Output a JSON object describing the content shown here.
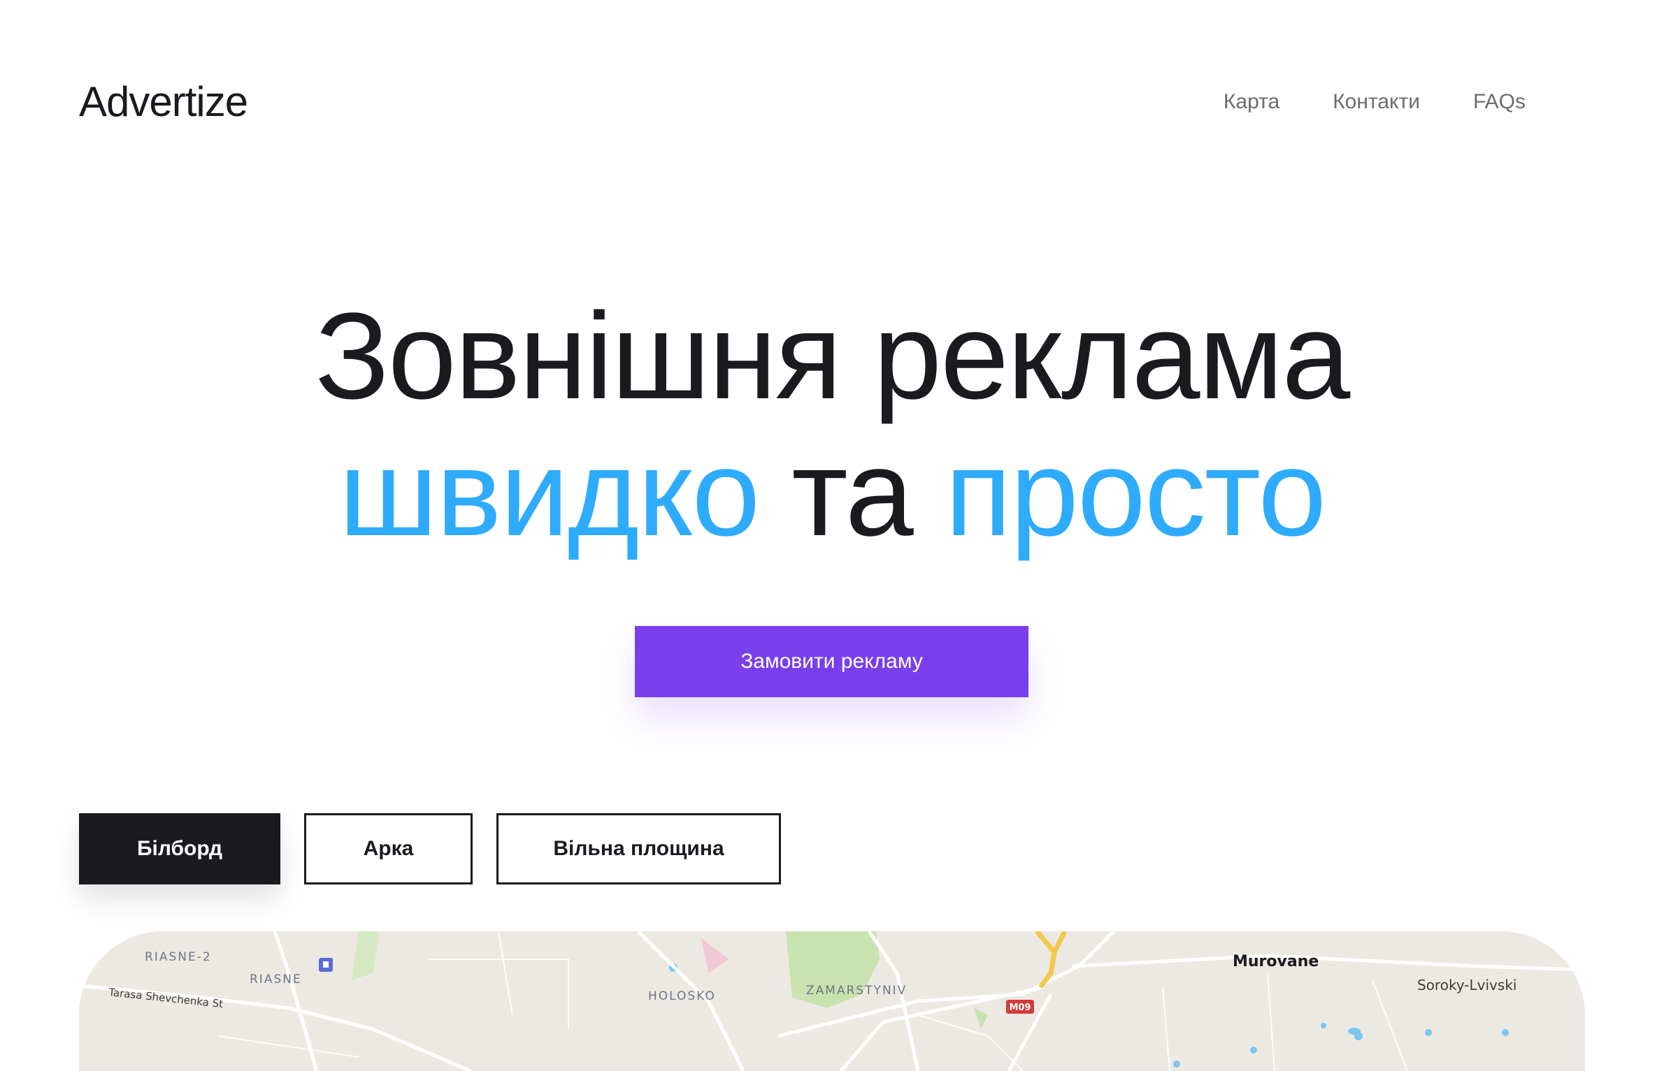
{
  "brand": {
    "logo": "Advertize"
  },
  "nav": {
    "items": [
      "Карта",
      "Контакти",
      "FAQs"
    ]
  },
  "hero": {
    "line1": "Зовнішня реклама",
    "accent1": "швидко",
    "connector": "та",
    "accent2": "просто"
  },
  "cta": {
    "label": "Замовити рекламу"
  },
  "filters": {
    "items": [
      "Білборд",
      "Арка",
      "Вільна площина"
    ],
    "active": "Білборд"
  },
  "map": {
    "labels": {
      "riasne2": "RIASNE-2",
      "riasne": "RIASNE",
      "street": "Tarasa Shevchenka St",
      "holosko": "HOLOSKO",
      "zamarstyniv": "ZAMARSTYNIV",
      "road": "M09",
      "murovane": "Murovane",
      "soroky": "Soroky-Lvivski"
    }
  },
  "colors": {
    "accent": "#2eabfd",
    "cta": "#7a3fec",
    "text": "#1b1a1f",
    "nav": "#6b6b70"
  }
}
